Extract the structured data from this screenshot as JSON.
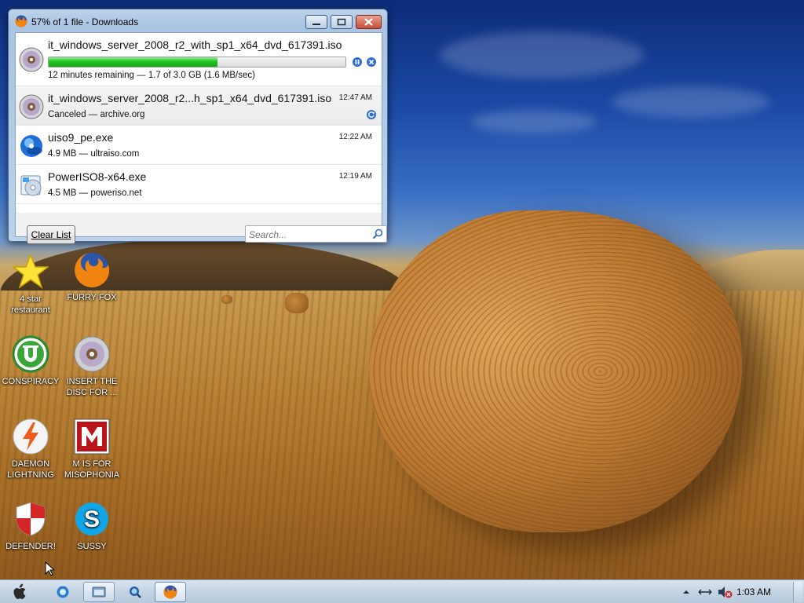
{
  "window": {
    "title": "57% of 1 file - Downloads",
    "minimize_icon": "minimize-icon",
    "maximize_icon": "maximize-icon",
    "close_icon": "close-icon"
  },
  "downloads": [
    {
      "name": "it_windows_server_2008_r2_with_sp1_x64_dvd_617391.iso",
      "status": "12 minutes remaining — 1.7 of 3.0 GB (1.6 MB/sec)",
      "progress": 0.57,
      "icon": "disc-icon",
      "actions": [
        "pause",
        "cancel"
      ]
    },
    {
      "name": "it_windows_server_2008_r2...h_sp1_x64_dvd_617391.iso",
      "status": "Canceled — archive.org",
      "time": "12:47 AM",
      "icon": "disc-icon",
      "actions": [
        "retry"
      ]
    },
    {
      "name": "uiso9_pe.exe",
      "status": "4.9 MB — ultraiso.com",
      "time": "12:22 AM",
      "icon": "ultraiso-icon"
    },
    {
      "name": "PowerISO8-x64.exe",
      "status": "4.5 MB — poweriso.net",
      "time": "12:19 AM",
      "icon": "poweriso-icon"
    }
  ],
  "footer": {
    "clear_label": "Clear List",
    "search_placeholder": "Search..."
  },
  "desktop_icons": [
    {
      "label": "4 star restaurant",
      "icon": "star-icon"
    },
    {
      "label": "FURRY FOX",
      "icon": "firefox-icon"
    },
    {
      "label": "CONSPIRACY",
      "icon": "utorrent-icon"
    },
    {
      "label": "INSERT THE DISC FOR ...",
      "icon": "disc-icon"
    },
    {
      "label": "DAEMON LIGHTNING",
      "icon": "daemon-tools-icon"
    },
    {
      "label": "M IS FOR MISOPHONIA",
      "icon": "mcafee-icon"
    },
    {
      "label": "DEFENDER!",
      "icon": "shield-icon"
    },
    {
      "label": "SUSSY",
      "icon": "skype-icon"
    }
  ],
  "taskbar": {
    "clock": "1:03 AM",
    "items": [
      "apple-start-icon",
      "ie-icon",
      "explorer-icon",
      "search-app-icon",
      "firefox-icon"
    ],
    "tray": [
      "show-hidden-icon",
      "network-icon",
      "volume-muted-icon"
    ]
  },
  "colors": {
    "progress_fill": "#21c321",
    "action_blue": "#2f6fd1",
    "taskbar": "#c4d4e4"
  }
}
